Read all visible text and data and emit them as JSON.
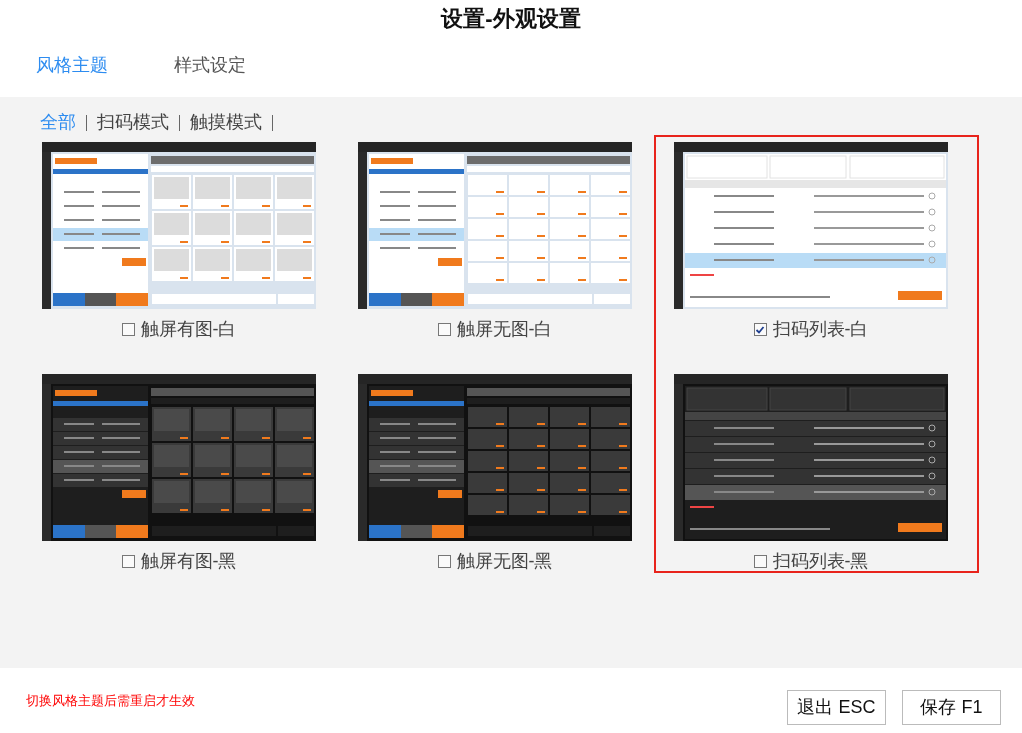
{
  "window": {
    "title": "设置-外观设置"
  },
  "tabs": [
    {
      "label": "风格主题",
      "selected": true
    },
    {
      "label": "样式设定",
      "selected": false
    }
  ],
  "filters": [
    {
      "label": "全部",
      "selected": true
    },
    {
      "label": "扫码模式",
      "selected": false
    },
    {
      "label": "触摸模式",
      "selected": false
    }
  ],
  "themes": [
    {
      "label": "触屏有图-白",
      "checked": false,
      "kind": "touch-image",
      "dark": false
    },
    {
      "label": "触屏无图-白",
      "checked": false,
      "kind": "touch-plain",
      "dark": false
    },
    {
      "label": "扫码列表-白",
      "checked": true,
      "kind": "scan-list",
      "dark": false
    },
    {
      "label": "触屏有图-黑",
      "checked": false,
      "kind": "touch-image",
      "dark": true
    },
    {
      "label": "触屏无图-黑",
      "checked": false,
      "kind": "touch-plain",
      "dark": true
    },
    {
      "label": "扫码列表-黑",
      "checked": false,
      "kind": "scan-list",
      "dark": true
    }
  ],
  "notice": "切换风格主题后需重启才生效",
  "buttons": [
    {
      "label": "退出 ESC"
    },
    {
      "label": "保存 F1"
    }
  ]
}
